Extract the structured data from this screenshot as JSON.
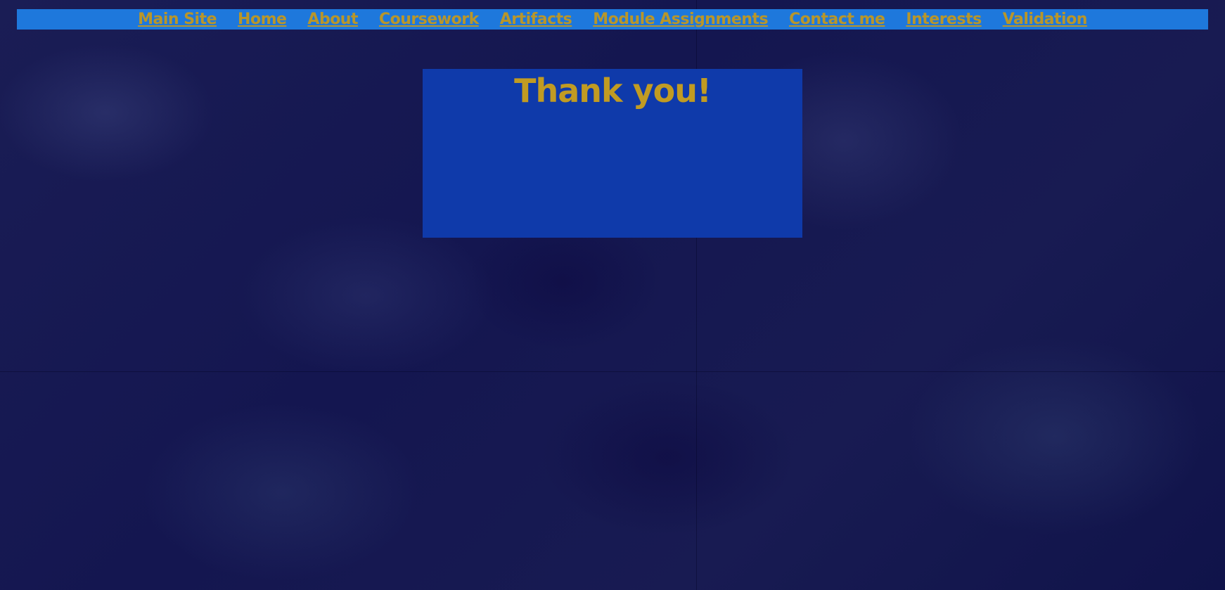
{
  "nav": {
    "items": [
      {
        "label": "Main Site"
      },
      {
        "label": "Home"
      },
      {
        "label": "About"
      },
      {
        "label": "Coursework"
      },
      {
        "label": "Artifacts"
      },
      {
        "label": "Module Assignments"
      },
      {
        "label": "Contact me"
      },
      {
        "label": "Interests"
      },
      {
        "label": "Validation"
      }
    ]
  },
  "main": {
    "title": "Thank you!"
  },
  "colors": {
    "nav_background": "#1e78dc",
    "link_color": "#b8962a",
    "card_background": "#0f3aaa",
    "title_color": "#c19b22",
    "page_background": "#121545"
  }
}
